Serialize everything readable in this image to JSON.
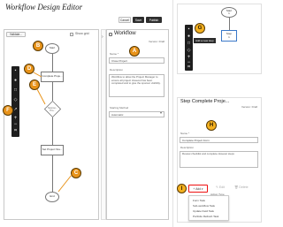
{
  "title": "Workflow Design Editor",
  "canvas": {
    "validate_label": "Validate...",
    "show_grid_label": "Show grid",
    "nodes": {
      "start": "Start",
      "complete": "Complete Proje...",
      "decision": "Sponso... Pro...",
      "set": "Set Project Sta...",
      "end": "End"
    }
  },
  "toolbar_buttons": {
    "cancel": "Cancel",
    "save": "Save",
    "publish": "Publish"
  },
  "properties": {
    "heading": "Workflow",
    "status": "Version: Draft",
    "name_label": "Name *",
    "name_value": "Close Project",
    "description_label": "Description",
    "description_value": "Workflow to allow the Project Manager to ensure all project closeout has been completed and to give the sponsor visibility.",
    "starting_method_label": "Starting Method",
    "starting_method_value": "Automatic"
  },
  "minimap": {
    "start_label": "Start",
    "start_sub": "1",
    "step_label": "Step",
    "step_sub": "1",
    "tooltip": "Add a new step"
  },
  "step_panel": {
    "heading": "Step Complete Proje...",
    "status": "Version: Draft",
    "name_label": "Name *",
    "name_value": "Complete Project Form",
    "description_label": "Description",
    "description_value": "Review checklist and complete closeout steps",
    "add_label": "Add",
    "edit_label": "Edit",
    "delete_label": "Delete",
    "column_header": "Action Type",
    "menu": [
      "Form Task",
      "Sub-workflow Task",
      "Update Field Task",
      "Portfolio Refresh Task"
    ]
  },
  "callouts": [
    "A",
    "B",
    "C",
    "D",
    "E",
    "F",
    "G",
    "H",
    "I"
  ],
  "colors": {
    "badge_orange": "#e8931a",
    "badge_gold": "#f4b120",
    "highlight": "#e11111",
    "toolbar": "#1e1e1e"
  }
}
